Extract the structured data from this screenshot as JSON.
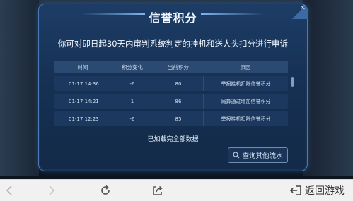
{
  "dialog": {
    "title": "信誉积分",
    "subtitle": "你可对即日起30天内审判系统判定的挂机和送人头扣分进行申诉",
    "table": {
      "headers": [
        "时间",
        "积分变化",
        "当前积分",
        "原因"
      ],
      "rows": [
        {
          "time": "01-17  14:36",
          "change": "-6",
          "current": "80",
          "reason": "举报挂机扣除信誉积分"
        },
        {
          "time": "01-17  14:21",
          "change": "1",
          "current": "86",
          "reason": "局算通过增加信誉积分"
        },
        {
          "time": "01-17  12:23",
          "change": "-6",
          "current": "85",
          "reason": "举报挂机扣除信誉积分"
        }
      ]
    },
    "loaded_text": "已加载完全部数据",
    "query_button": "查询其他流水"
  },
  "bottom_bar": {
    "back_label": "返回游戏",
    "icons": [
      "back-arrow-icon",
      "forward-arrow-icon",
      "refresh-icon",
      "share-icon",
      "exit-icon"
    ]
  }
}
